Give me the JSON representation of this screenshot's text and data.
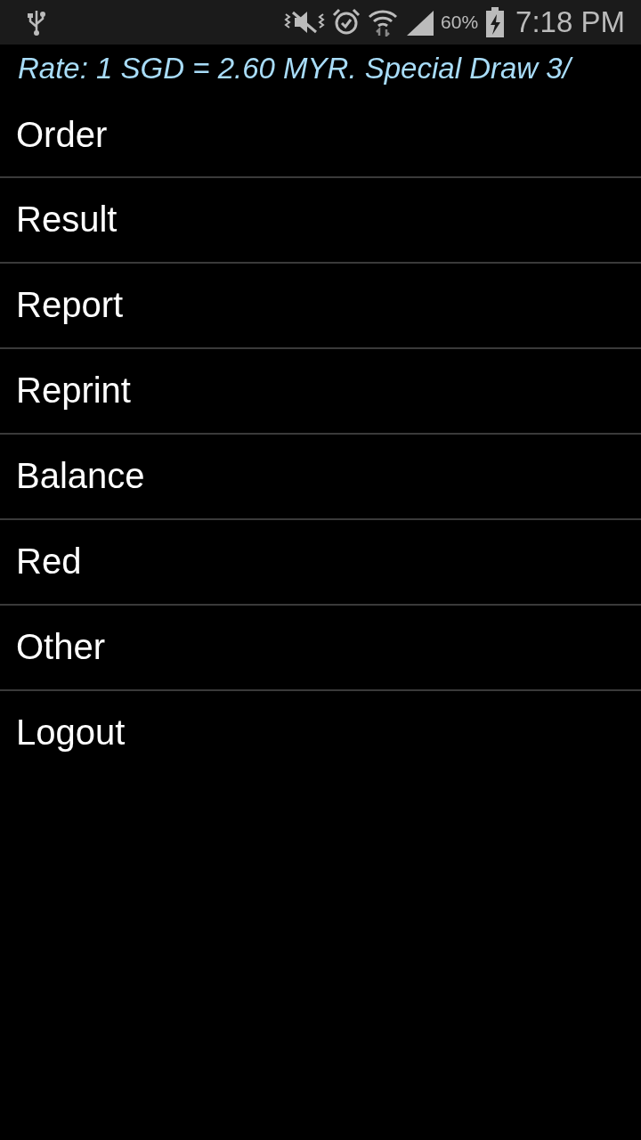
{
  "status_bar": {
    "battery": "60%",
    "time": "7:18 PM"
  },
  "marquee": "Rate: 1 SGD = 2.60 MYR. Special Draw 3/",
  "menu": [
    {
      "label": "Order"
    },
    {
      "label": "Result"
    },
    {
      "label": "Report"
    },
    {
      "label": "Reprint"
    },
    {
      "label": "Balance"
    },
    {
      "label": "Red"
    },
    {
      "label": "Other"
    },
    {
      "label": "Logout"
    }
  ]
}
